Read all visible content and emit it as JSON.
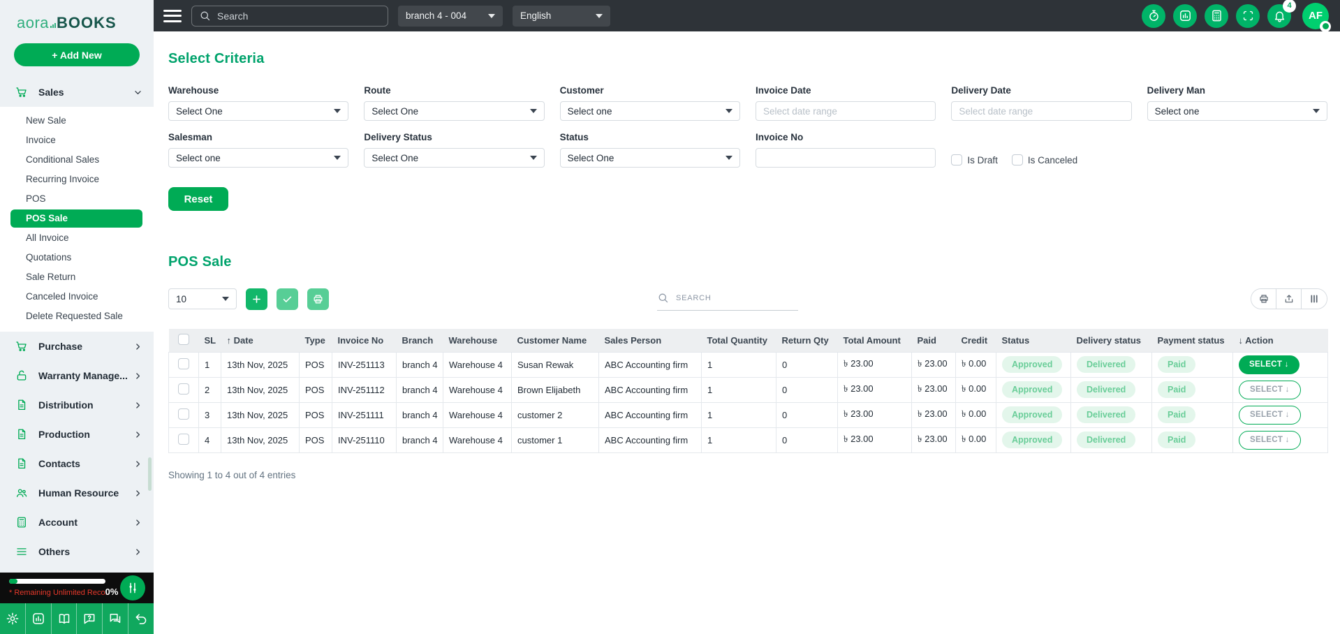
{
  "colors": {
    "primary_green": "#00ab55",
    "heading_green": "#00a36c",
    "topbar_bg": "#2e3338",
    "sidebar_bg": "#edf1f4",
    "status_pill_bg": "#e3f6eb",
    "status_pill_text": "#69cd98",
    "danger_red": "#e8392b"
  },
  "brand": {
    "name_primary": "aora",
    "name_secondary": "BOOKS",
    "add_new_label": "+ Add New"
  },
  "topbar": {
    "search_placeholder": "Search",
    "branch": "branch 4 - 004",
    "language": "English",
    "notification_count": "4",
    "avatar_initials": "AF"
  },
  "sidebar": {
    "sections": [
      {
        "label": "Sales",
        "icon": "cart",
        "expanded": true
      },
      {
        "label": "Purchase",
        "icon": "cart"
      },
      {
        "label": "Warranty Manage...",
        "icon": "lock-open"
      },
      {
        "label": "Distribution",
        "icon": "document"
      },
      {
        "label": "Production",
        "icon": "document"
      },
      {
        "label": "Contacts",
        "icon": "document"
      },
      {
        "label": "Human Resource",
        "icon": "people"
      },
      {
        "label": "Account",
        "icon": "calculator"
      },
      {
        "label": "Others",
        "icon": "menu-lines"
      }
    ],
    "sales_submenu": {
      "items": [
        "New Sale",
        "Invoice",
        "Conditional Sales",
        "Recurring Invoice",
        "POS",
        "POS Sale",
        "All Invoice",
        "Quotations",
        "Sale Return",
        "Canceled Invoice",
        "Delete Requested Sale"
      ],
      "active": "POS Sale"
    },
    "footer": {
      "remaining_label": "* Remaining Unlimited Reco..",
      "remaining_value": "0%"
    }
  },
  "criteria": {
    "title": "Select Criteria",
    "warehouse": {
      "label": "Warehouse",
      "value": "Select One"
    },
    "route": {
      "label": "Route",
      "value": "Select One"
    },
    "customer": {
      "label": "Customer",
      "value": "Select one"
    },
    "invoice_date": {
      "label": "Invoice Date",
      "placeholder": "Select date range"
    },
    "delivery_date": {
      "label": "Delivery Date",
      "placeholder": "Select date range"
    },
    "delivery_man": {
      "label": "Delivery Man",
      "value": "Select one"
    },
    "salesman": {
      "label": "Salesman",
      "value": "Select one"
    },
    "delivery_status": {
      "label": "Delivery Status",
      "value": "Select One"
    },
    "status": {
      "label": "Status",
      "value": "Select One"
    },
    "invoice_no": {
      "label": "Invoice No",
      "value": ""
    },
    "is_draft_label": "Is Draft",
    "is_canceled_label": "Is Canceled",
    "reset_label": "Reset"
  },
  "table": {
    "title": "POS Sale",
    "page_size": "10",
    "search_placeholder": "SEARCH",
    "showing": "Showing 1 to 4 out of 4 entries",
    "columns": [
      {
        "key": "checkbox",
        "label": "",
        "type": "checkbox"
      },
      {
        "key": "sl",
        "label": "SL"
      },
      {
        "key": "date",
        "label": "Date",
        "sort": "asc"
      },
      {
        "key": "type",
        "label": "Type"
      },
      {
        "key": "invoice_no",
        "label": "Invoice No"
      },
      {
        "key": "branch",
        "label": "Branch"
      },
      {
        "key": "warehouse",
        "label": "Warehouse"
      },
      {
        "key": "customer_name",
        "label": "Customer Name"
      },
      {
        "key": "sales_person",
        "label": "Sales Person"
      },
      {
        "key": "total_quantity",
        "label": "Total Quantity"
      },
      {
        "key": "return_qty",
        "label": "Return Qty"
      },
      {
        "key": "total_amount",
        "label": "Total Amount"
      },
      {
        "key": "paid",
        "label": "Paid"
      },
      {
        "key": "credit",
        "label": "Credit"
      },
      {
        "key": "status",
        "label": "Status",
        "type": "pill"
      },
      {
        "key": "delivery_status",
        "label": "Delivery status",
        "type": "pill"
      },
      {
        "key": "payment_status",
        "label": "Payment status",
        "type": "pill"
      },
      {
        "key": "action",
        "label": "Action",
        "sort": "desc",
        "type": "action"
      }
    ],
    "action_label": "SELECT",
    "rows": [
      {
        "sl": "1",
        "date": "13th Nov, 2025",
        "type": "POS",
        "invoice_no": "INV-251113",
        "branch": "branch 4",
        "warehouse": "Warehouse 4",
        "customer_name": "Susan Rewak",
        "sales_person": "ABC Accounting firm",
        "total_quantity": "1",
        "return_qty": "0",
        "total_amount": "৳ 23.00",
        "paid": "৳ 23.00",
        "credit": "৳ 0.00",
        "status": "Approved",
        "delivery_status": "Delivered",
        "payment_status": "Paid",
        "action_variant": "solid"
      },
      {
        "sl": "2",
        "date": "13th Nov, 2025",
        "type": "POS",
        "invoice_no": "INV-251112",
        "branch": "branch 4",
        "warehouse": "Warehouse 4",
        "customer_name": "Brown Elijabeth",
        "sales_person": "ABC Accounting firm",
        "total_quantity": "1",
        "return_qty": "0",
        "total_amount": "৳ 23.00",
        "paid": "৳ 23.00",
        "credit": "৳ 0.00",
        "status": "Approved",
        "delivery_status": "Delivered",
        "payment_status": "Paid",
        "action_variant": "outline"
      },
      {
        "sl": "3",
        "date": "13th Nov, 2025",
        "type": "POS",
        "invoice_no": "INV-251111",
        "branch": "branch 4",
        "warehouse": "Warehouse 4",
        "customer_name": "customer 2",
        "sales_person": "ABC Accounting firm",
        "total_quantity": "1",
        "return_qty": "0",
        "total_amount": "৳ 23.00",
        "paid": "৳ 23.00",
        "credit": "৳ 0.00",
        "status": "Approved",
        "delivery_status": "Delivered",
        "payment_status": "Paid",
        "action_variant": "outline"
      },
      {
        "sl": "4",
        "date": "13th Nov, 2025",
        "type": "POS",
        "invoice_no": "INV-251110",
        "branch": "branch 4",
        "warehouse": "Warehouse 4",
        "customer_name": "customer 1",
        "sales_person": "ABC Accounting firm",
        "total_quantity": "1",
        "return_qty": "0",
        "total_amount": "৳ 23.00",
        "paid": "৳ 23.00",
        "credit": "৳ 0.00",
        "status": "Approved",
        "delivery_status": "Delivered",
        "payment_status": "Paid",
        "action_variant": "outline"
      }
    ]
  }
}
